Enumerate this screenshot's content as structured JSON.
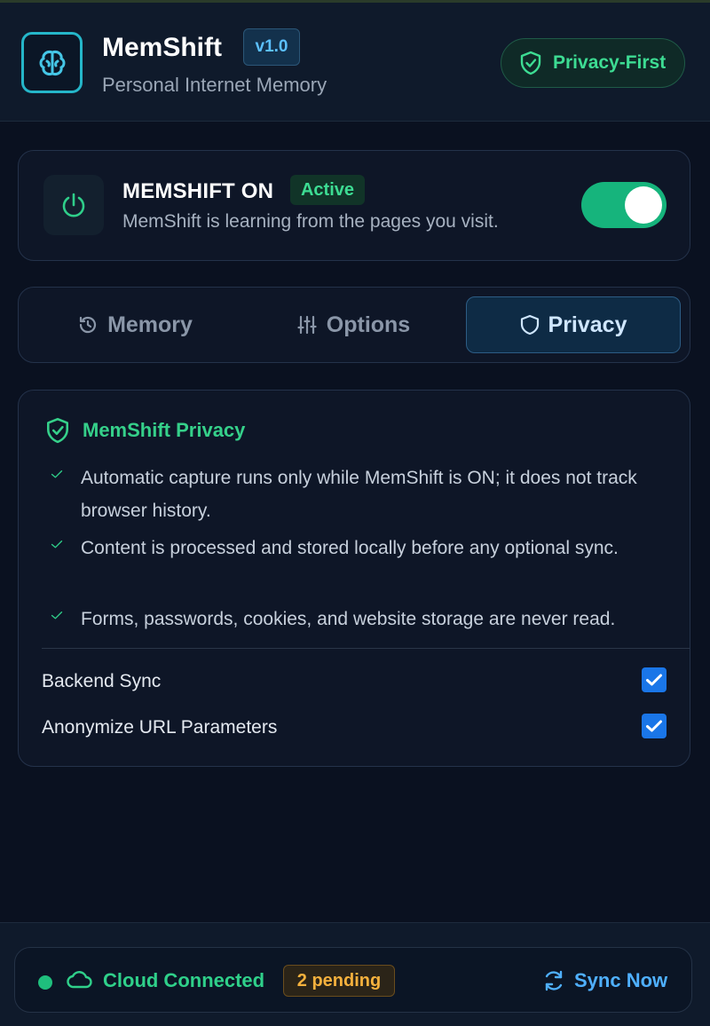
{
  "header": {
    "app_name": "MemShift",
    "version": "v1.0",
    "subtitle": "Personal Internet Memory",
    "privacy_badge": "Privacy-First",
    "logo_icon": "brain-icon"
  },
  "status": {
    "title": "MEMSHIFT ON",
    "badge": "Active",
    "description": "MemShift is learning from the pages you visit.",
    "toggle_on": true,
    "icon": "power-icon"
  },
  "tabs": [
    {
      "label": "Memory",
      "icon": "history-icon",
      "selected": false
    },
    {
      "label": "Options",
      "icon": "sliders-icon",
      "selected": false
    },
    {
      "label": "Privacy",
      "icon": "shield-icon",
      "selected": true
    }
  ],
  "privacy": {
    "title": "MemShift Privacy",
    "points": [
      "Automatic capture runs only while MemShift is ON; it does not track browser history.",
      "Content is processed and stored locally before any optional sync.",
      "Forms, passwords, cookies, and website storage are never read."
    ],
    "settings": [
      {
        "label": "Backend Sync",
        "checked": true
      },
      {
        "label": "Anonymize URL Parameters",
        "checked": true
      }
    ]
  },
  "footer": {
    "connection": "Cloud Connected",
    "pending": "2 pending",
    "sync_label": "Sync Now"
  },
  "colors": {
    "accent_green": "#3ddc93",
    "accent_blue": "#4fb0ff",
    "toggle_on": "#16b47c",
    "pending_amber": "#f5b13d",
    "background": "#0a1120"
  }
}
